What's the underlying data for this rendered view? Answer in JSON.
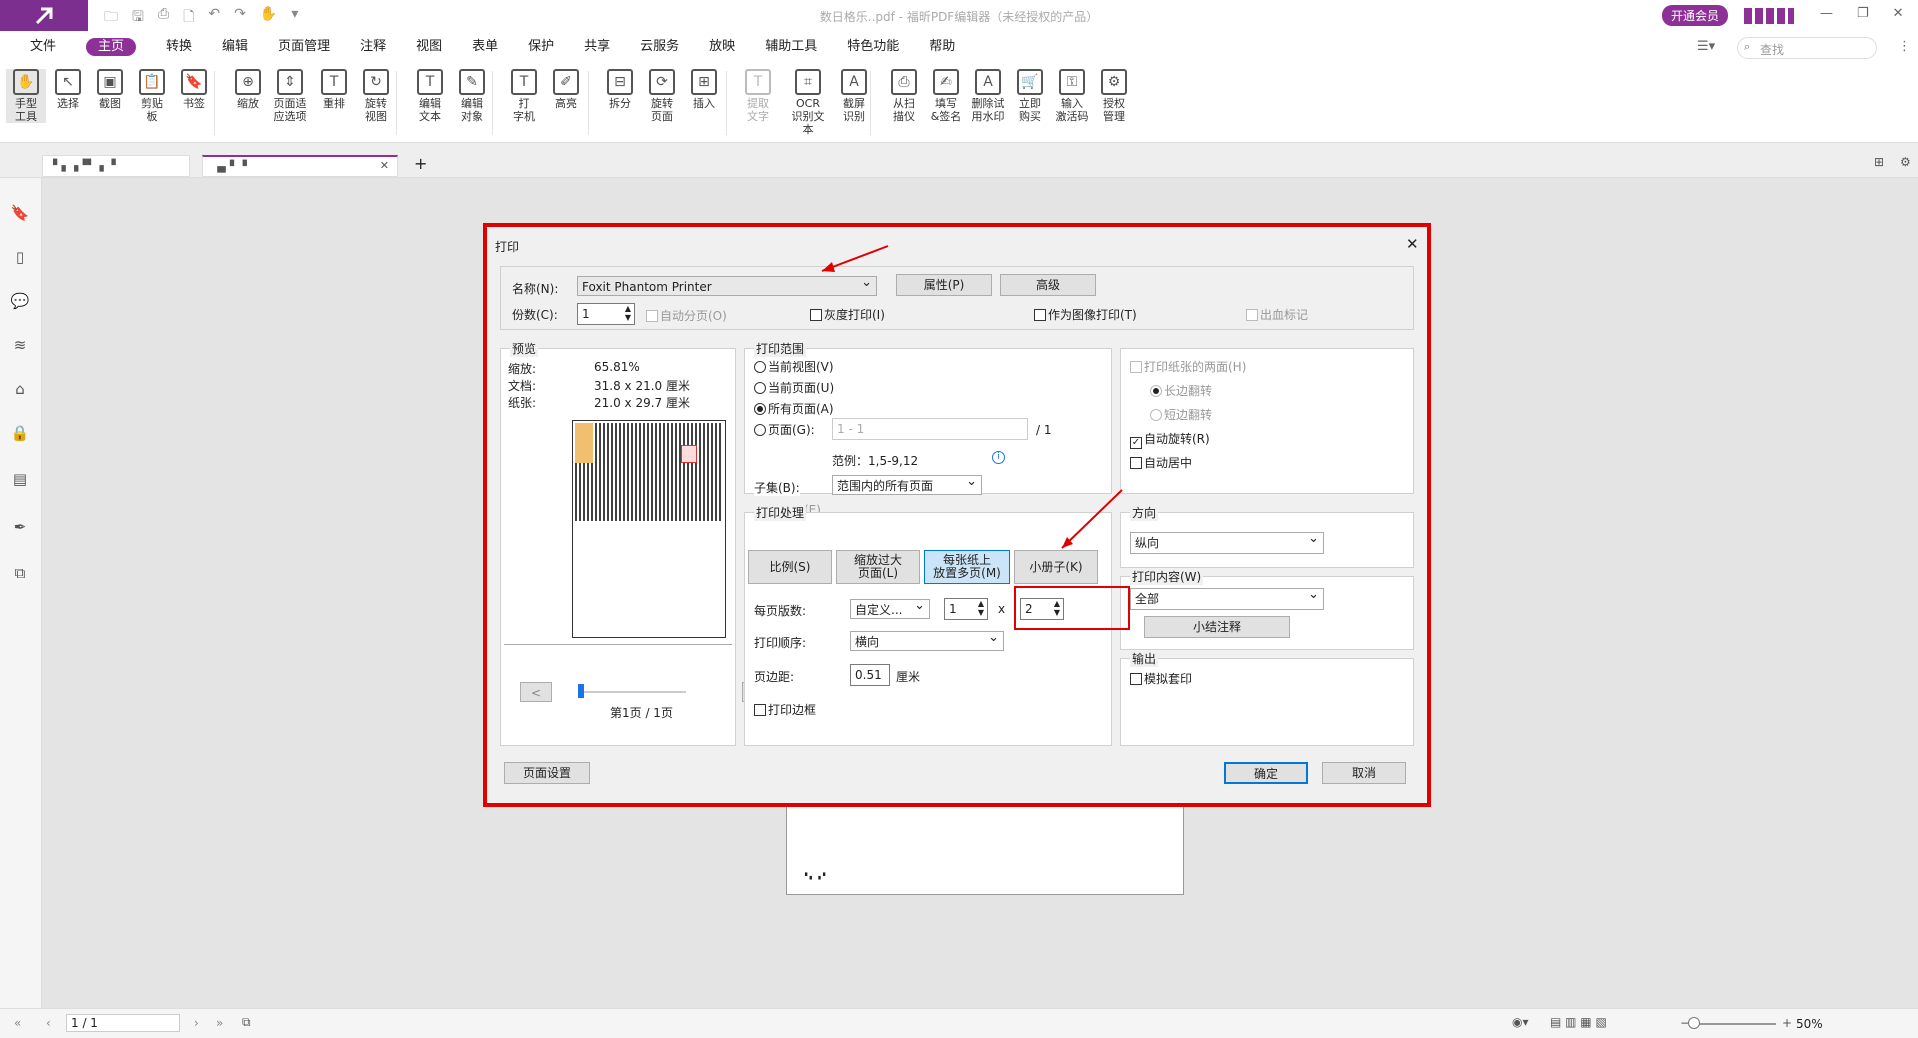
{
  "window": {
    "title": "数日格乐..pdf - 福昕PDF编辑器（未经授权的产品）",
    "vip": "开通会员",
    "search_placeholder": "查找"
  },
  "quick_icons": [
    "open-icon",
    "save-icon",
    "print-icon",
    "new-icon",
    "undo-icon",
    "redo-icon",
    "hand-icon",
    "dropdown-icon"
  ],
  "menu": [
    "文件",
    "主页",
    "转换",
    "编辑",
    "页面管理",
    "注释",
    "视图",
    "表单",
    "保护",
    "共享",
    "云服务",
    "放映",
    "辅助工具",
    "特色功能",
    "帮助"
  ],
  "active_menu": "主页",
  "ribbon": [
    {
      "l1": "手型",
      "l2": "工具",
      "i": "✋"
    },
    {
      "l1": "选择",
      "l2": "",
      "i": "↖"
    },
    {
      "l1": "截图",
      "l2": "",
      "i": "▣"
    },
    {
      "l1": "剪贴",
      "l2": "板",
      "i": "📋"
    },
    {
      "l1": "书签",
      "l2": "",
      "i": "🔖"
    },
    {
      "l1": "缩放",
      "l2": "",
      "i": "⊕"
    },
    {
      "l1": "页面适",
      "l2": "应选项",
      "i": "⇕"
    },
    {
      "l1": "重排",
      "l2": "",
      "i": "T"
    },
    {
      "l1": "旋转",
      "l2": "视图",
      "i": "↻"
    },
    {
      "l1": "编辑",
      "l2": "文本",
      "i": "T"
    },
    {
      "l1": "编辑",
      "l2": "对象",
      "i": "✎"
    },
    {
      "l1": "打",
      "l2": "字机",
      "i": "T"
    },
    {
      "l1": "高亮",
      "l2": "",
      "i": "✐"
    },
    {
      "l1": "拆分",
      "l2": "",
      "i": "⊟"
    },
    {
      "l1": "旋转",
      "l2": "页面",
      "i": "⟳"
    },
    {
      "l1": "插入",
      "l2": "",
      "i": "⊞"
    },
    {
      "l1": "提取",
      "l2": "文字",
      "i": "T"
    },
    {
      "l1": "OCR",
      "l2": "识别文本",
      "i": "⌗"
    },
    {
      "l1": "截屏",
      "l2": "识别",
      "i": "A"
    },
    {
      "l1": "从扫",
      "l2": "描仪",
      "i": "⎙"
    },
    {
      "l1": "填写",
      "l2": "&签名",
      "i": "✍"
    },
    {
      "l1": "删除试",
      "l2": "用水印",
      "i": "A"
    },
    {
      "l1": "立即",
      "l2": "购买",
      "i": "🛒"
    },
    {
      "l1": "输入",
      "l2": "激活码",
      "i": "⚿"
    },
    {
      "l1": "授权",
      "l2": "管理",
      "i": "⚙"
    }
  ],
  "tabs": [
    "▘▖▗▝▘▗ ▝",
    "▗▖▘▝"
  ],
  "dialog": {
    "title": "打印",
    "printer_label": "名称(N):",
    "printer": "Foxit Phantom Printer",
    "properties": "属性(P)",
    "advanced": "高级",
    "copies_label": "份数(C):",
    "copies": "1",
    "collate": "自动分页(O)",
    "grayscale": "灰度打印(I)",
    "as_image": "作为图像打印(T)",
    "bleed": "出血标记",
    "preview": {
      "title": "预览",
      "zoom_label": "缩放:",
      "zoom": "65.81%",
      "doc_label": "文档:",
      "doc": "31.8 x 21.0 厘米",
      "paper_label": "纸张:",
      "paper": "21.0 x 29.7 厘米",
      "page_info": "第1页 / 1页",
      "prev": "<",
      "next": ">",
      "setup": "页面设置"
    },
    "range": {
      "title": "打印范围",
      "current_view": "当前视图(V)",
      "current_page": "当前页面(U)",
      "all_pages": "所有页面(A)",
      "pages": "页面(G):",
      "pages_placeholder": "1 - 1",
      "total": "/ 1",
      "example": "范例：1,5-9,12",
      "subset_label": "子集(B):",
      "subset": "范围内的所有页面",
      "reverse": "逆页序(E)"
    },
    "handling": {
      "title": "打印处理",
      "scale": "比例(S)",
      "shrink": "缩放过大\n页面(L)",
      "multi": "每张纸上\n放置多页(M)",
      "booklet": "小册子(K)",
      "pps_label": "每页版数:",
      "pps": "自定义...",
      "cols": "1",
      "x": "x",
      "rows": "2",
      "order_label": "打印顺序:",
      "order": "横向",
      "margin_label": "页边距:",
      "margin": "0.51",
      "unit": "厘米",
      "border": "打印边框"
    },
    "duplex": {
      "both": "打印纸张的两面(H)",
      "long": "长边翻转",
      "short": "短边翻转",
      "auto_rotate": "自动旋转(R)",
      "auto_center": "自动居中"
    },
    "orientation": {
      "title": "方向",
      "value": "纵向"
    },
    "content": {
      "title": "打印内容(W)",
      "value": "全部",
      "summarize": "小结注释"
    },
    "output": {
      "title": "输出",
      "simulate": "模拟套印"
    },
    "ok": "确定",
    "cancel": "取消"
  },
  "bg_page_label": "▘▖ ▗▝",
  "status": {
    "page": "1 / 1",
    "zoom": "50%"
  }
}
